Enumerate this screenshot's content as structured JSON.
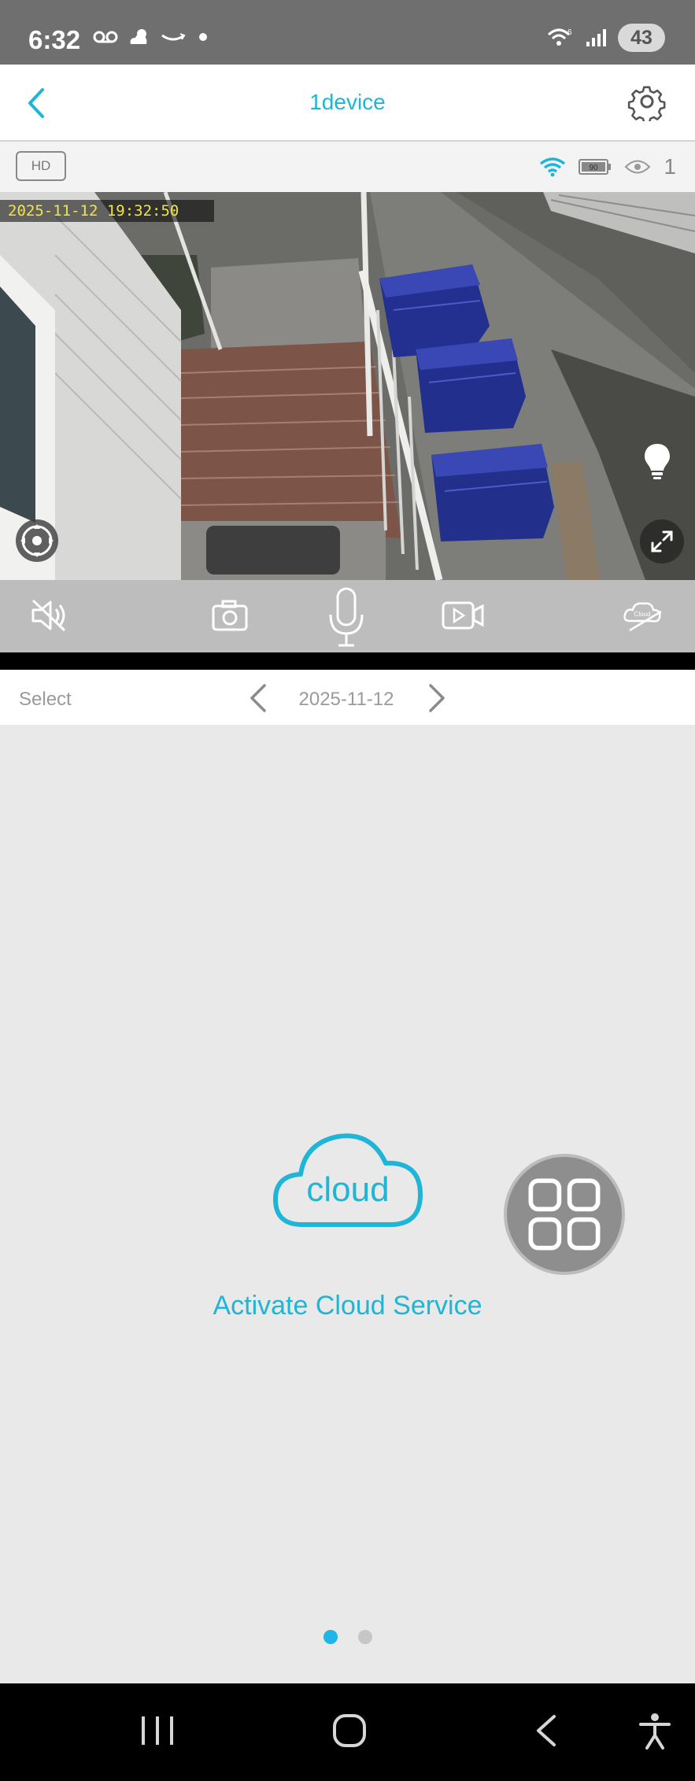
{
  "status_bar": {
    "time": "6:32",
    "battery": "43",
    "left_icons": [
      "voicemail-icon",
      "weather-icon",
      "amazon-icon",
      "dot-icon"
    ],
    "right_icons": [
      "wifi-6-icon",
      "signal-icon",
      "battery-icon"
    ]
  },
  "header": {
    "title": "1device",
    "back_icon": "chevron-left-icon",
    "settings_icon": "gear-icon"
  },
  "camera_info": {
    "quality_label": "HD",
    "battery_level_label": "90",
    "viewer_count": "1"
  },
  "video": {
    "timestamp": "2025-11-12 19:32:50"
  },
  "controls": {
    "items": [
      "mute-icon",
      "snapshot-icon",
      "microphone-icon",
      "record-icon",
      "cloud-off-icon"
    ],
    "cloud_badge_label": "Cloud"
  },
  "date_selector": {
    "select_label": "Select",
    "date": "2025-11-12"
  },
  "cloud": {
    "icon_word": "cloud",
    "activate_label": "Activate Cloud Service"
  },
  "pager": {
    "count": 2,
    "active_index": 0
  },
  "colors": {
    "accent": "#1fb5d6",
    "status_bar": "#6f6f6f",
    "background": "#e9e9e9",
    "timestamp_text": "#f2e44a"
  }
}
